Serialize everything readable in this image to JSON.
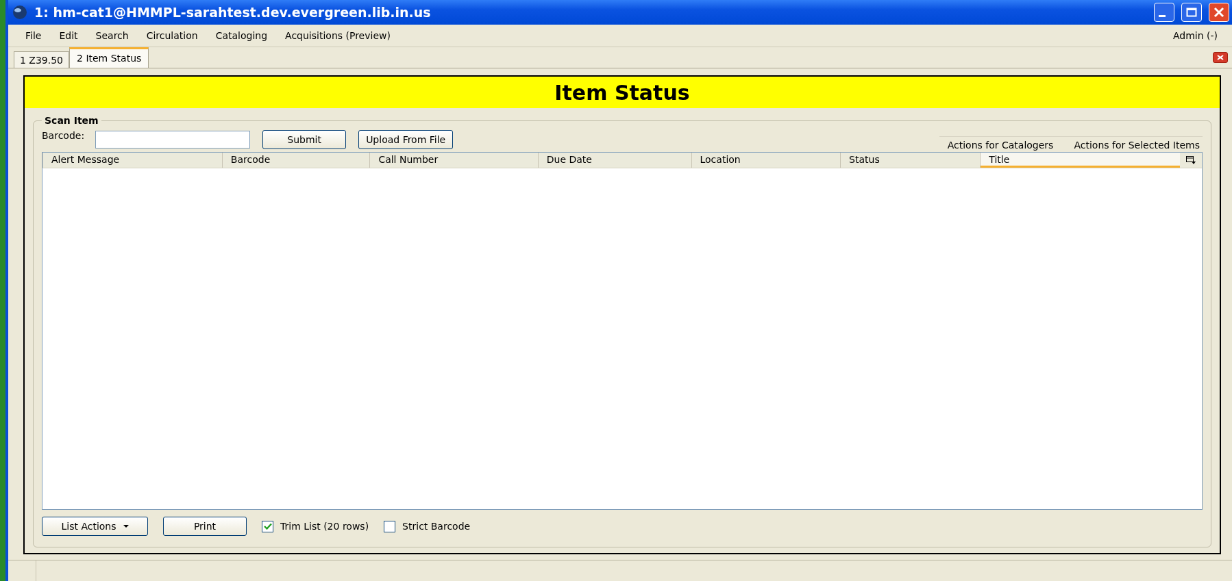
{
  "window": {
    "title": "1: hm-cat1@HMMPL-sarahtest.dev.evergreen.lib.in.us"
  },
  "menu": [
    "File",
    "Edit",
    "Search",
    "Circulation",
    "Cataloging",
    "Acquisitions (Preview)"
  ],
  "user_menu": "Admin (-)",
  "tabs": [
    {
      "label": "1 Z39.50",
      "selected": false
    },
    {
      "label": "2 Item Status",
      "selected": true
    }
  ],
  "header": "Item Status",
  "scan": {
    "legend": "Scan Item",
    "barcode_label": "Barcode:",
    "submit": "Submit",
    "upload": "Upload From File",
    "actions": [
      "Actions for Catalogers",
      "Actions for Selected Items"
    ]
  },
  "table": {
    "columns": [
      {
        "label": "Alert Message",
        "sorted": false
      },
      {
        "label": "Barcode",
        "sorted": false
      },
      {
        "label": "Call Number",
        "sorted": false
      },
      {
        "label": "Due Date",
        "sorted": false
      },
      {
        "label": "Location",
        "sorted": false
      },
      {
        "label": "Status",
        "sorted": false
      },
      {
        "label": "Title",
        "sorted": true
      }
    ]
  },
  "footer": {
    "list_actions": "List Actions",
    "print": "Print",
    "checkboxes": [
      {
        "label": "Trim List (20 rows)",
        "checked": true
      },
      {
        "label": "Strict Barcode",
        "checked": false
      }
    ]
  }
}
